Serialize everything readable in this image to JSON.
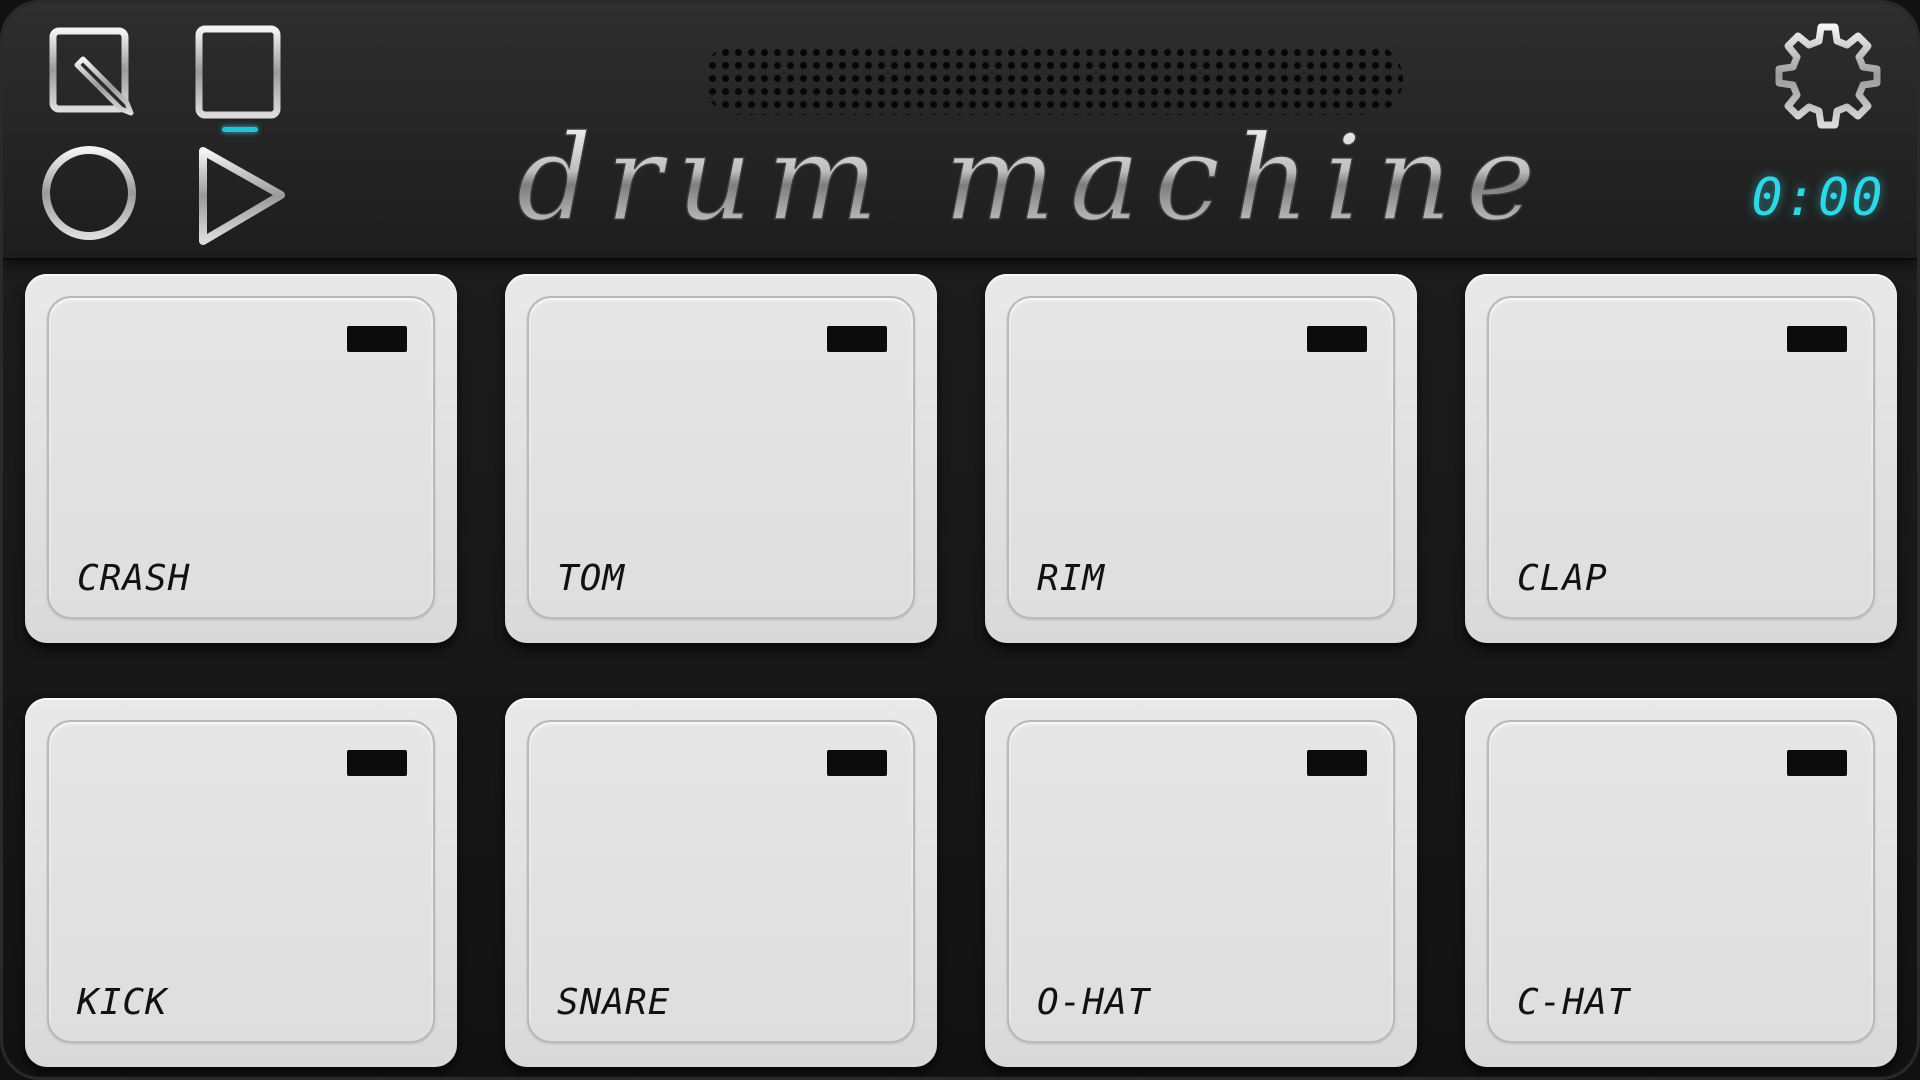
{
  "header": {
    "logo_text": "drum machine",
    "timer": "0:00",
    "icons": {
      "edit": "edit-pencil-icon",
      "grid": "grid-icon",
      "record": "record-circle-icon",
      "play": "play-icon",
      "settings": "gear-icon"
    },
    "accent_color": "#27c3d4"
  },
  "pads": [
    {
      "label": "CRASH"
    },
    {
      "label": "TOM"
    },
    {
      "label": "RIM"
    },
    {
      "label": "CLAP"
    },
    {
      "label": "KICK"
    },
    {
      "label": "SNARE"
    },
    {
      "label": "O-HAT"
    },
    {
      "label": "C-HAT"
    }
  ]
}
